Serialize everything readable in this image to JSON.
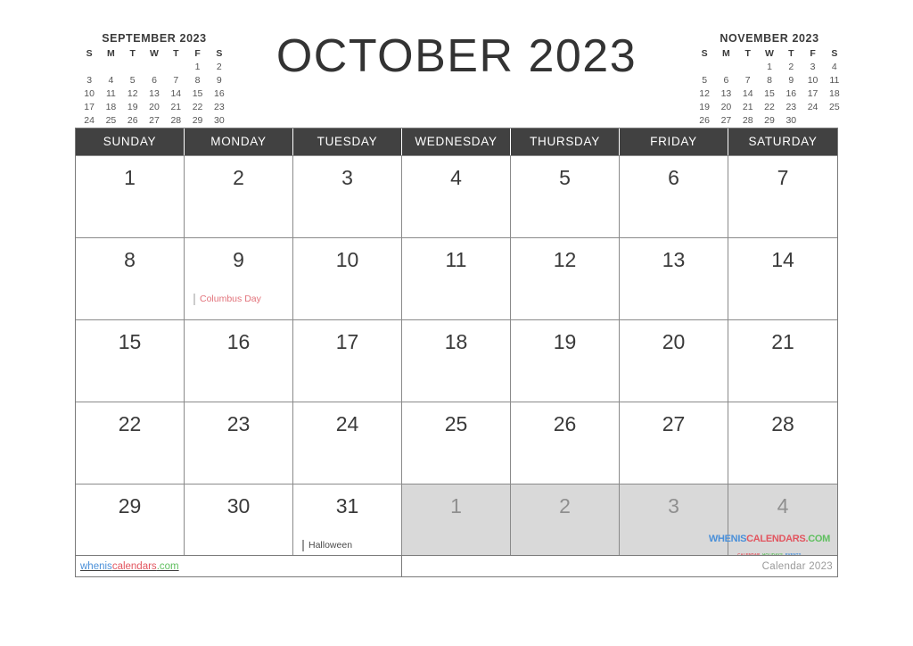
{
  "title": "OCTOBER 2023",
  "mini_calendars": [
    {
      "name": "september",
      "title": "SEPTEMBER 2023",
      "dow": [
        "S",
        "M",
        "T",
        "W",
        "T",
        "F",
        "S"
      ],
      "weeks": [
        [
          "",
          "",
          "",
          "",
          "",
          "1",
          "2"
        ],
        [
          "3",
          "4",
          "5",
          "6",
          "7",
          "8",
          "9"
        ],
        [
          "10",
          "11",
          "12",
          "13",
          "14",
          "15",
          "16"
        ],
        [
          "17",
          "18",
          "19",
          "20",
          "21",
          "22",
          "23"
        ],
        [
          "24",
          "25",
          "26",
          "27",
          "28",
          "29",
          "30"
        ]
      ]
    },
    {
      "name": "november",
      "title": "NOVEMBER 2023",
      "dow": [
        "S",
        "M",
        "T",
        "W",
        "T",
        "F",
        "S"
      ],
      "weeks": [
        [
          "",
          "",
          "",
          "1",
          "2",
          "3",
          "4"
        ],
        [
          "5",
          "6",
          "7",
          "8",
          "9",
          "10",
          "11"
        ],
        [
          "12",
          "13",
          "14",
          "15",
          "16",
          "17",
          "18"
        ],
        [
          "19",
          "20",
          "21",
          "22",
          "23",
          "24",
          "25"
        ],
        [
          "26",
          "27",
          "28",
          "29",
          "30",
          "",
          ""
        ]
      ]
    }
  ],
  "weekday_headers": [
    "SUNDAY",
    "MONDAY",
    "TUESDAY",
    "WEDNESDAY",
    "THURSDAY",
    "FRIDAY",
    "SATURDAY"
  ],
  "weeks": [
    [
      {
        "num": "1",
        "out": false,
        "event": ""
      },
      {
        "num": "2",
        "out": false,
        "event": ""
      },
      {
        "num": "3",
        "out": false,
        "event": ""
      },
      {
        "num": "4",
        "out": false,
        "event": ""
      },
      {
        "num": "5",
        "out": false,
        "event": ""
      },
      {
        "num": "6",
        "out": false,
        "event": ""
      },
      {
        "num": "7",
        "out": false,
        "event": ""
      }
    ],
    [
      {
        "num": "8",
        "out": false,
        "event": ""
      },
      {
        "num": "9",
        "out": false,
        "event": "Columbus Day",
        "holiday": true
      },
      {
        "num": "10",
        "out": false,
        "event": ""
      },
      {
        "num": "11",
        "out": false,
        "event": ""
      },
      {
        "num": "12",
        "out": false,
        "event": ""
      },
      {
        "num": "13",
        "out": false,
        "event": ""
      },
      {
        "num": "14",
        "out": false,
        "event": ""
      }
    ],
    [
      {
        "num": "15",
        "out": false,
        "event": ""
      },
      {
        "num": "16",
        "out": false,
        "event": ""
      },
      {
        "num": "17",
        "out": false,
        "event": ""
      },
      {
        "num": "18",
        "out": false,
        "event": ""
      },
      {
        "num": "19",
        "out": false,
        "event": ""
      },
      {
        "num": "20",
        "out": false,
        "event": ""
      },
      {
        "num": "21",
        "out": false,
        "event": ""
      }
    ],
    [
      {
        "num": "22",
        "out": false,
        "event": ""
      },
      {
        "num": "23",
        "out": false,
        "event": ""
      },
      {
        "num": "24",
        "out": false,
        "event": ""
      },
      {
        "num": "25",
        "out": false,
        "event": ""
      },
      {
        "num": "26",
        "out": false,
        "event": ""
      },
      {
        "num": "27",
        "out": false,
        "event": ""
      },
      {
        "num": "28",
        "out": false,
        "event": ""
      }
    ],
    [
      {
        "num": "29",
        "out": false,
        "event": ""
      },
      {
        "num": "30",
        "out": false,
        "event": ""
      },
      {
        "num": "31",
        "out": false,
        "event": "Halloween",
        "holiday": false
      },
      {
        "num": "1",
        "out": true,
        "event": ""
      },
      {
        "num": "2",
        "out": true,
        "event": ""
      },
      {
        "num": "3",
        "out": true,
        "event": ""
      },
      {
        "num": "4",
        "out": true,
        "event": "",
        "logo": true
      }
    ]
  ],
  "logo": {
    "part1": "WHENIS",
    "part2": "CALENDARS.",
    "part3": "COM",
    "sub1": "CALENDAR",
    "sub2": "HOLIDAYS",
    "sub3": "EVENTS"
  },
  "footer": {
    "link_part1": "whenis",
    "link_part2": "calendars",
    "link_part3": ".com",
    "note": "Calendar 2023"
  },
  "colors": {
    "header_bg": "#414141",
    "out_cell": "#d9d9d9",
    "holiday_text": "#e2737b",
    "blue": "#4a90d9",
    "red": "#e2555f",
    "green": "#5fbf5f"
  }
}
